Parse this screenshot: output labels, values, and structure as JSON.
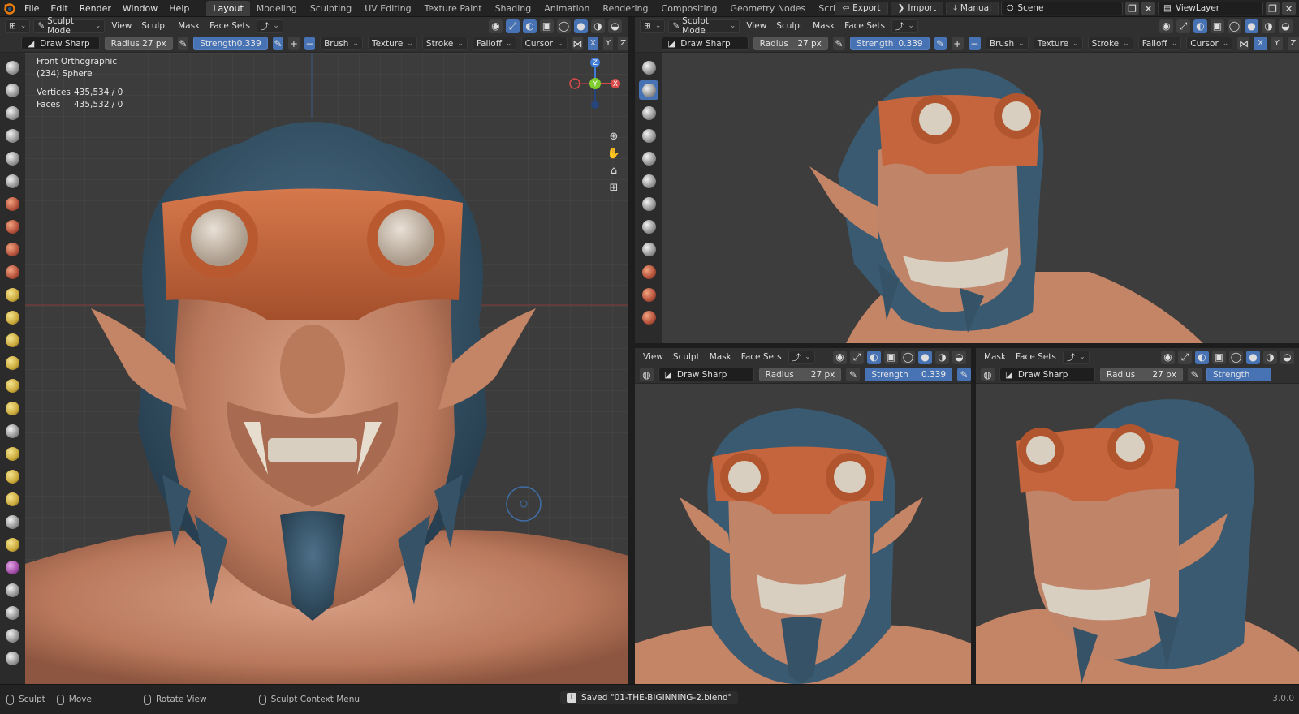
{
  "menu": [
    "File",
    "Edit",
    "Render",
    "Window",
    "Help"
  ],
  "workspaces": [
    "Layout",
    "Modeling",
    "Sculpting",
    "UV Editing",
    "Texture Paint",
    "Shading",
    "Animation",
    "Rendering",
    "Compositing",
    "Geometry Nodes",
    "Scripting"
  ],
  "active_workspace": "Layout",
  "top_right": {
    "export": "Export",
    "import": "Import",
    "manual": "Manual",
    "scene": "Scene",
    "view_layer": "ViewLayer"
  },
  "header": {
    "mode": "Sculpt Mode",
    "view": "View",
    "sculpt": "Sculpt",
    "mask": "Mask",
    "face_sets": "Face Sets"
  },
  "toolsettings": {
    "brush_name": "Draw Sharp",
    "radius_label": "Radius",
    "radius_value": "27 px",
    "strength_label": "Strength",
    "strength_value": "0.339",
    "brush": "Brush",
    "texture": "Texture",
    "stroke": "Stroke",
    "falloff": "Falloff",
    "cursor": "Cursor",
    "axes": [
      "X",
      "Y",
      "Z"
    ]
  },
  "overlay_info": {
    "view_name": "Front Orthographic",
    "object": "(234) Sphere",
    "vertices_label": "Vertices",
    "vertices_value": "435,534 / 0",
    "faces_label": "Faces",
    "faces_value": "435,532 / 0"
  },
  "gizmo": {
    "z": "Z",
    "y": "Y",
    "x": "X"
  },
  "status": {
    "sculpt": "Sculpt",
    "move": "Move",
    "rotate": "Rotate View",
    "context": "Sculpt Context Menu",
    "saved": "Saved \"01-THE-BIGINNING-2.blend\"",
    "version": "3.0.0"
  },
  "colors": {
    "accent": "#4772b3",
    "skin": "#c88a6d",
    "goggles": "#c4653d",
    "hair": "#3a5a6e",
    "viewport_bg": "#3c3c3c"
  }
}
